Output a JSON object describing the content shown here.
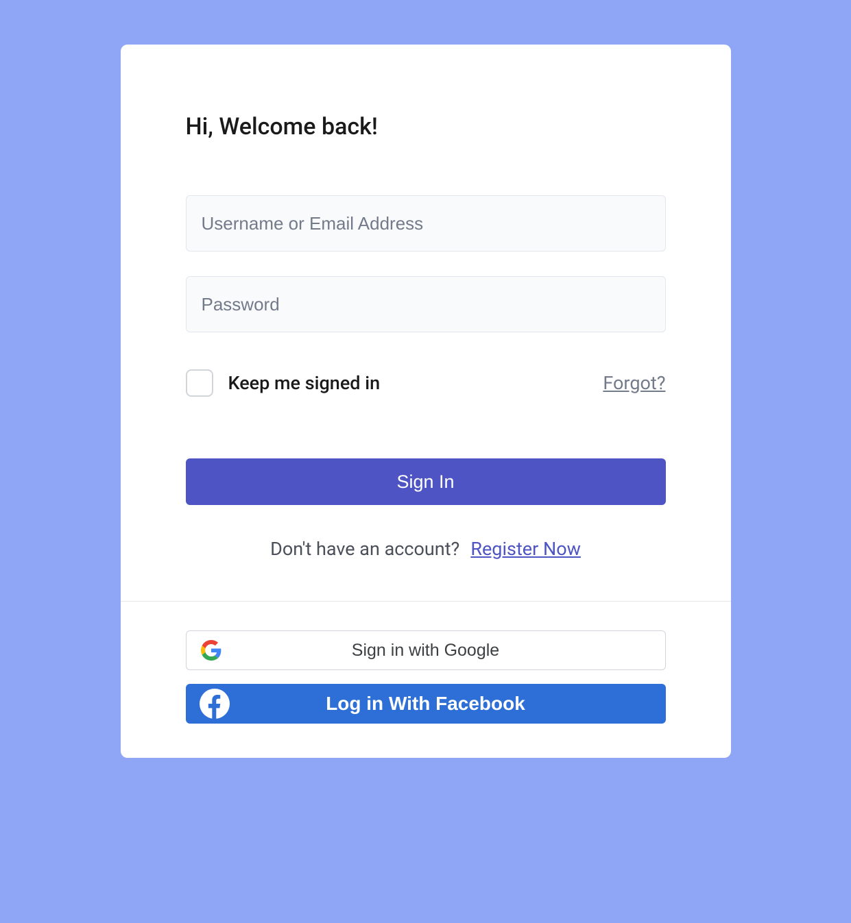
{
  "title": "Hi, Welcome back!",
  "inputs": {
    "username_placeholder": "Username or Email Address",
    "password_placeholder": "Password"
  },
  "checkbox": {
    "label": "Keep me signed in"
  },
  "forgot_label": "Forgot?",
  "signin_label": "Sign In",
  "register": {
    "prompt": "Don't have an account?",
    "link": "Register Now"
  },
  "social": {
    "google_label": "Sign in with Google",
    "facebook_label": "Log in With Facebook"
  }
}
